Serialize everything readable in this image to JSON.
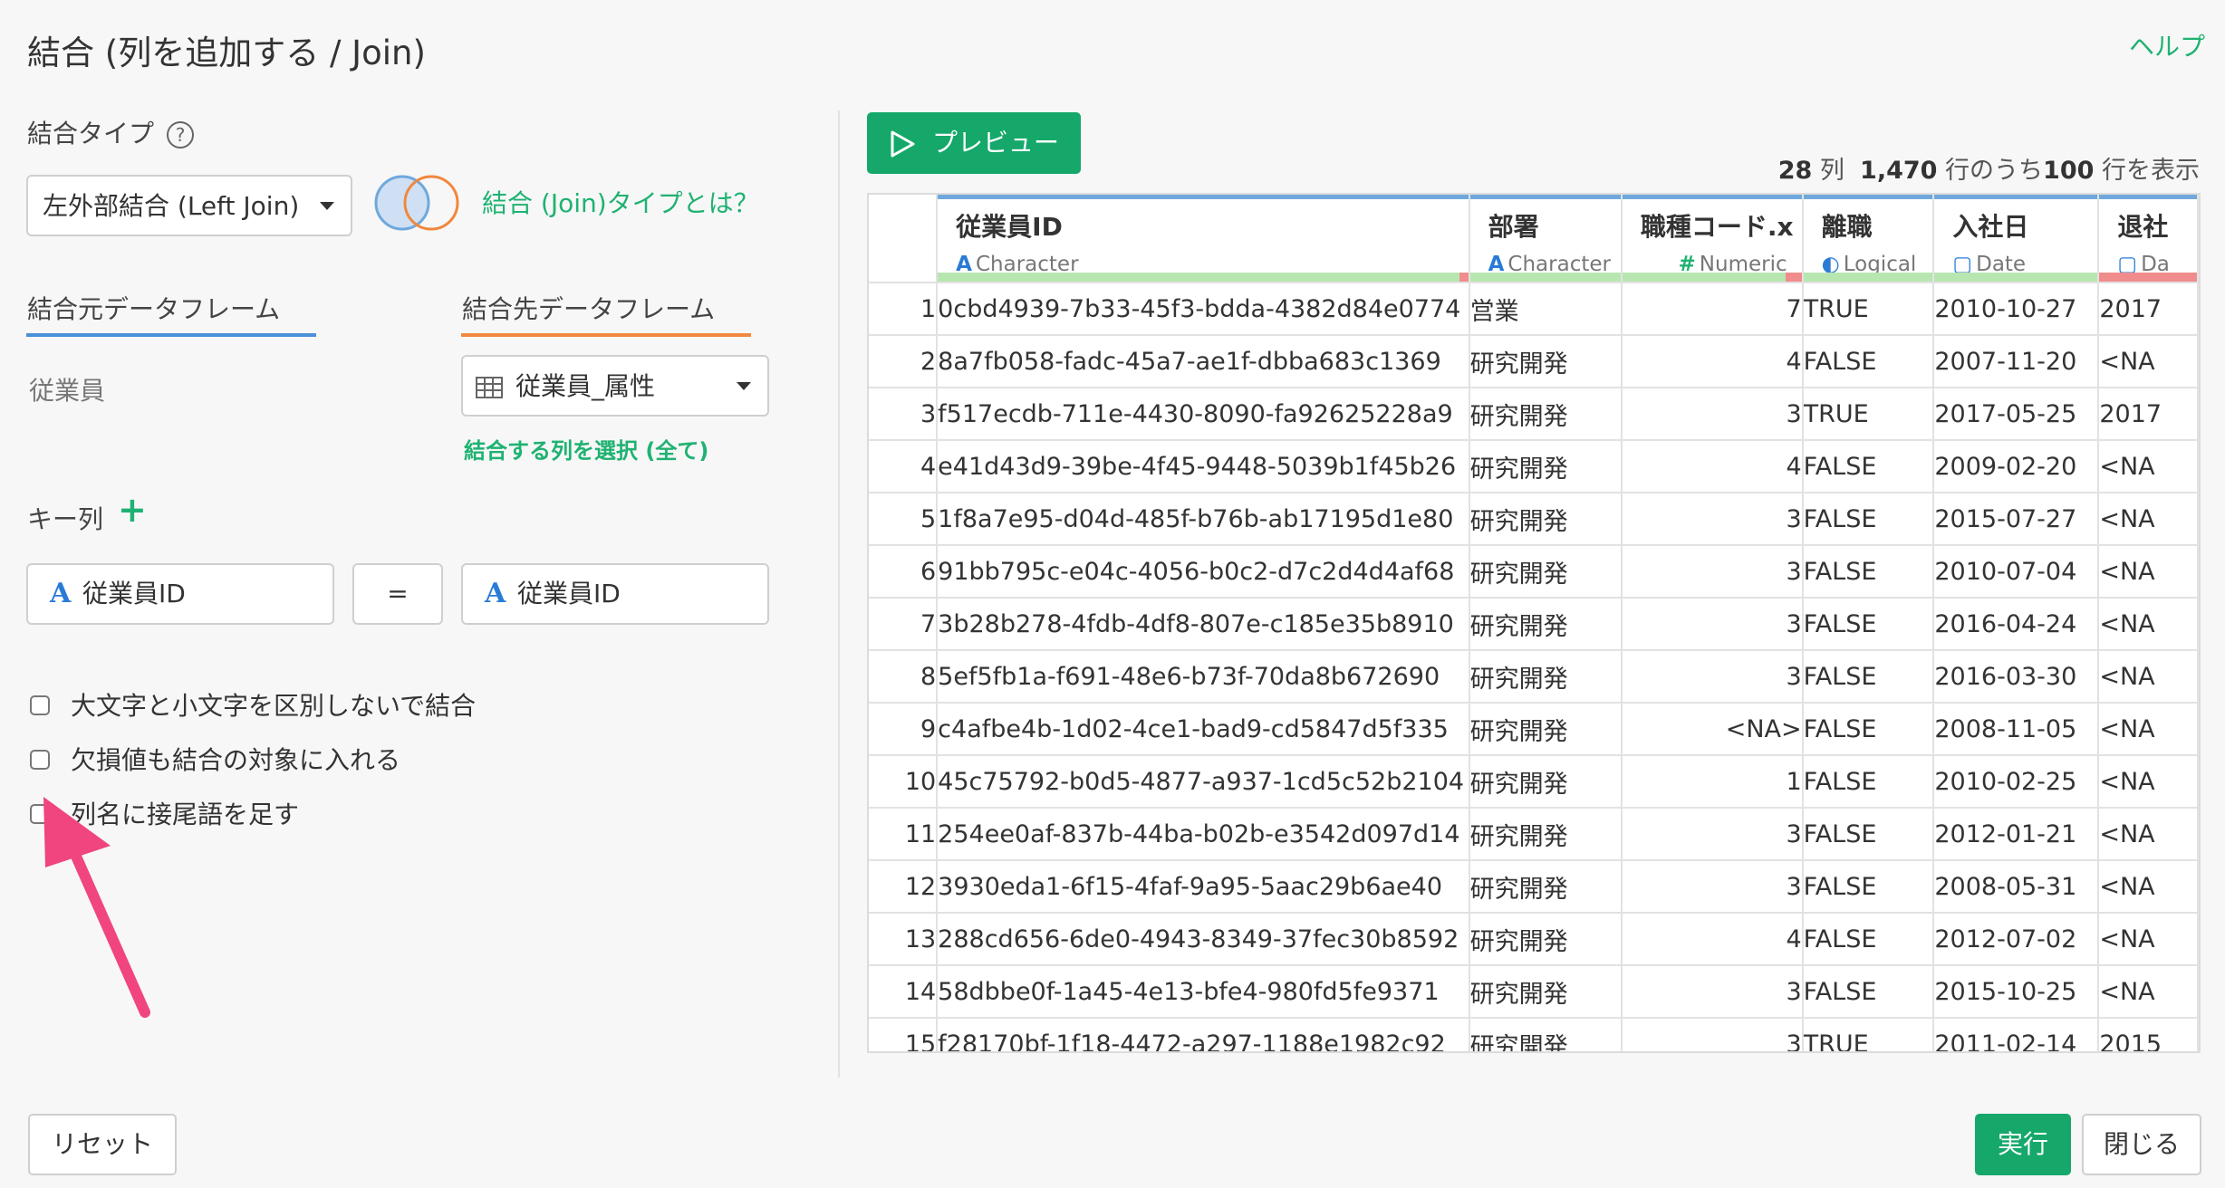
{
  "title": "結合 (列を追加する / Join)",
  "help_label": "ヘルプ",
  "join_type": {
    "label": "結合タイプ",
    "help_icon": "?",
    "selected": "左外部結合 (Left Join)",
    "about_link": "結合 (Join)タイプとは？"
  },
  "source": {
    "tab_label": "結合元データフレーム",
    "name": "従業員"
  },
  "target": {
    "tab_label": "結合先データフレーム",
    "selected": "従業員_属性",
    "select_columns_link": "結合する列を選択 (全て)"
  },
  "keys": {
    "label": "キー列",
    "add_icon": "+",
    "left": "従業員ID",
    "equals": "=",
    "right": "従業員ID",
    "type_icon": "A"
  },
  "options": [
    "大文字と小文字を区別しないで結合",
    "欠損値も結合の対象に入れる",
    "列名に接尾語を足す"
  ],
  "preview": {
    "button_label": "プレビュー",
    "cols_count": "28",
    "cols_unit": "列",
    "rows_total": "1,470",
    "rows_mid": "行のうち",
    "rows_shown": "100",
    "rows_suffix": "行を表示"
  },
  "table": {
    "columns": [
      {
        "name": "従業員ID",
        "type_icon": "A",
        "type": "Character"
      },
      {
        "name": "部署",
        "type_icon": "A",
        "type": "Character"
      },
      {
        "name": "職種コード.x",
        "type_icon": "#",
        "type": "Numeric"
      },
      {
        "name": "離職",
        "type_icon": "◐",
        "type": "Logical"
      },
      {
        "name": "入社日",
        "type_icon": "▢",
        "type": "Date"
      },
      {
        "name": "退社",
        "type_icon": "▢",
        "type": "Da"
      }
    ],
    "rows": [
      [
        "1",
        "0cbd4939-7b33-45f3-bdda-4382d84e0774",
        "営業",
        "7",
        "TRUE",
        "2010-10-27",
        "2017"
      ],
      [
        "2",
        "8a7fb058-fadc-45a7-ae1f-dbba683c1369",
        "研究開発",
        "4",
        "FALSE",
        "2007-11-20",
        "<NA"
      ],
      [
        "3",
        "f517ecdb-711e-4430-8090-fa92625228a9",
        "研究開発",
        "3",
        "TRUE",
        "2017-05-25",
        "2017"
      ],
      [
        "4",
        "e41d43d9-39be-4f45-9448-5039b1f45b26",
        "研究開発",
        "4",
        "FALSE",
        "2009-02-20",
        "<NA"
      ],
      [
        "5",
        "1f8a7e95-d04d-485f-b76b-ab17195d1e80",
        "研究開発",
        "3",
        "FALSE",
        "2015-07-27",
        "<NA"
      ],
      [
        "6",
        "91bb795c-e04c-4056-b0c2-d7c2d4d4af68",
        "研究開発",
        "3",
        "FALSE",
        "2010-07-04",
        "<NA"
      ],
      [
        "7",
        "3b28b278-4fdb-4df8-807e-c185e35b8910",
        "研究開発",
        "3",
        "FALSE",
        "2016-04-24",
        "<NA"
      ],
      [
        "8",
        "5ef5fb1a-f691-48e6-b73f-70da8b672690",
        "研究開発",
        "3",
        "FALSE",
        "2016-03-30",
        "<NA"
      ],
      [
        "9",
        "c4afbe4b-1d02-4ce1-bad9-cd5847d5f335",
        "研究開発",
        "<NA>",
        "FALSE",
        "2008-11-05",
        "<NA"
      ],
      [
        "10",
        "45c75792-b0d5-4877-a937-1cd5c52b2104",
        "研究開発",
        "1",
        "FALSE",
        "2010-02-25",
        "<NA"
      ],
      [
        "11",
        "254ee0af-837b-44ba-b02b-e3542d097d14",
        "研究開発",
        "3",
        "FALSE",
        "2012-01-21",
        "<NA"
      ],
      [
        "12",
        "3930eda1-6f15-4faf-9a95-5aac29b6ae40",
        "研究開発",
        "3",
        "FALSE",
        "2008-05-31",
        "<NA"
      ],
      [
        "13",
        "288cd656-6de0-4943-8349-37fec30b8592",
        "研究開発",
        "4",
        "FALSE",
        "2012-07-02",
        "<NA"
      ],
      [
        "14",
        "58dbbe0f-1a45-4e13-bfe4-980fd5fe9371",
        "研究開発",
        "3",
        "FALSE",
        "2015-10-25",
        "<NA"
      ],
      [
        "15",
        "f28170bf-1f18-4472-a297-1188e1982c92",
        "研究開発",
        "3",
        "TRUE",
        "2011-02-14",
        "2015"
      ]
    ]
  },
  "footer": {
    "reset": "リセット",
    "run": "実行",
    "close": "閉じる"
  },
  "colors": {
    "accent_green": "#15a86a",
    "link_green": "#1fb272",
    "tab_blue": "#4a90d9",
    "tab_orange": "#f0883e",
    "annotation_arrow": "#f0457f"
  }
}
